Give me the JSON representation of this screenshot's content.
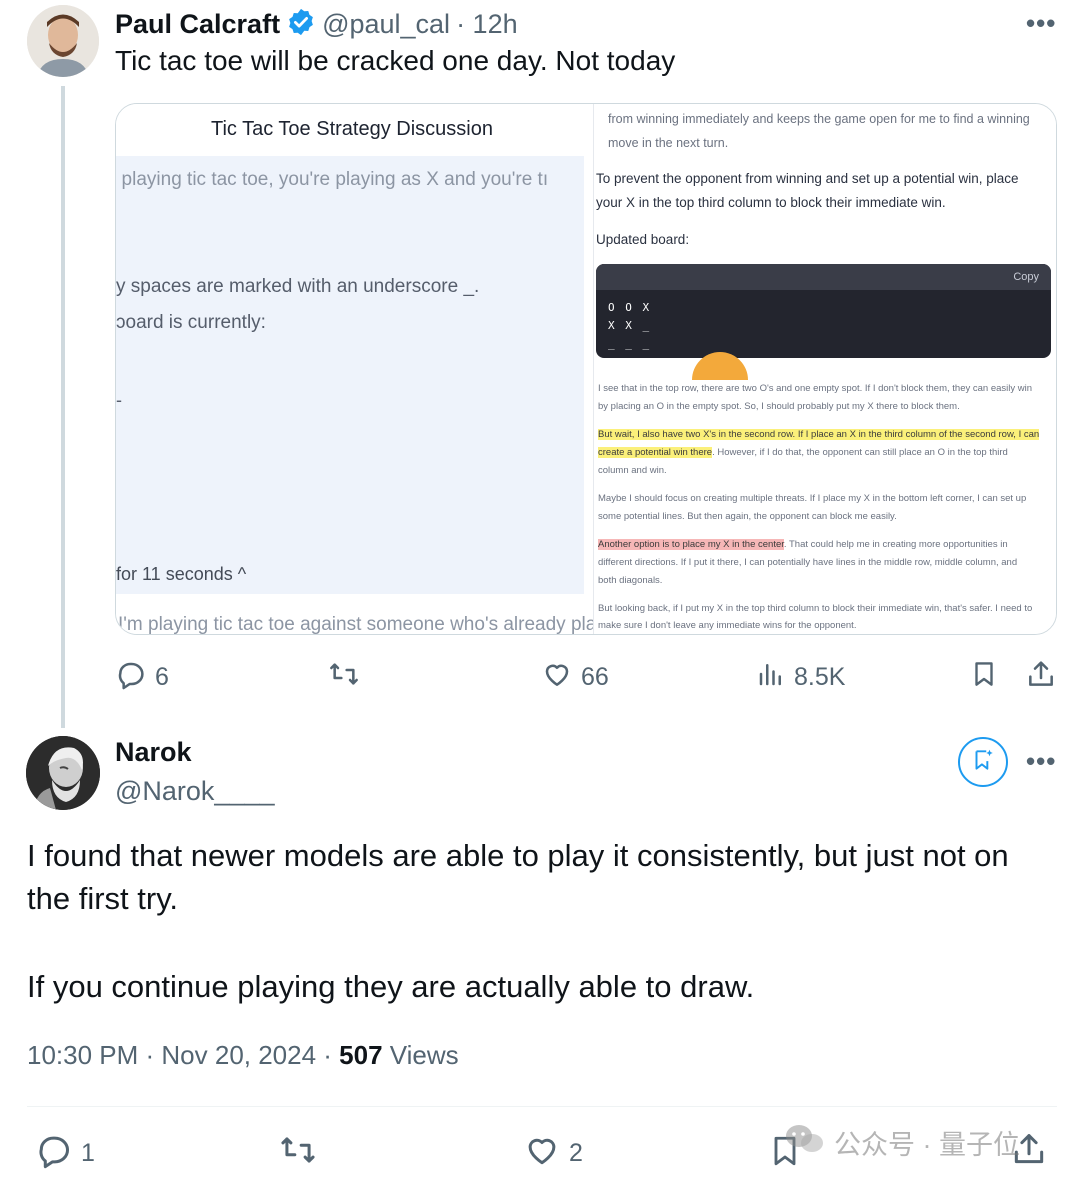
{
  "tweet1": {
    "author_name": "Paul Calcraft",
    "handle": "@paul_cal",
    "time": "· 12h",
    "text": "Tic tac toe will be cracked one day. Not today",
    "more_label": "•••",
    "media": {
      "left_title": "Tic Tac Toe Strategy Discussion",
      "left_line1": ": playing tic tac toe, you're playing as X and you're tı",
      "left_line2": "y spaces are marked with an underscore _.",
      "left_line3": "ɔoard is currently:",
      "left_marker": "-",
      "left_thought": "for 11 seconds ^",
      "left_bottom": "I'm playing tic tac toe against someone who's already placı",
      "right_top1": "from winning immediately and keeps the game open for me to find a winning",
      "right_top2": "move in the next turn.",
      "right_p1a": "To prevent the opponent from winning and set up a potential win, place",
      "right_p1b": "your X in the top third column to block their immediate win.",
      "right_updated": "Updated board:",
      "copy_label": "Copy",
      "board_row1": "O O X",
      "board_row2": "X X _",
      "board_row3": "_ _ _",
      "r1a": "I see that in the top row, there are two O's and one empty spot. If I don't block them, they can easily win",
      "r1b": "by placing an O in the empty spot. So, I should probably put my X there to block them.",
      "r2a": "But wait, I also have two X's in the second row. If I place an X in the third column of the second row, I can",
      "r2b_hl": "create a potential win there",
      "r2b_rest": ". However, if I do that, the opponent can still place an O in the top third",
      "r2c": "column and win.",
      "r3a": "Maybe I should focus on creating multiple threats. If I place my X in the bottom left corner, I can set up",
      "r3b": "some potential lines. But then again, the opponent can block me easily.",
      "r4a_hl": "Another option is to place my X in the center",
      "r4a_rest": ". That could help me in creating more opportunities in",
      "r4b": "different directions. If I put it there, I can potentially have lines in the middle row, middle column, and",
      "r4c": "both diagonals.",
      "r5a": "But looking back, if I put my X in the top third column to block their immediate win, that's safer. I need to",
      "r5b": "make sure I don't leave any immediate wins for the opponent."
    },
    "stats": {
      "replies": "6",
      "likes": "66",
      "views": "8.5K"
    }
  },
  "tweet2": {
    "author_name": "Narok",
    "handle": "@Narok____",
    "more_label": "•••",
    "line1": "I found that newer models are able to play it consistently, but just not on",
    "line2": "the first try.",
    "line3": "If you continue playing they are actually able to draw.",
    "time": "10:30 PM · Nov 20, 2024 · ",
    "views_count": "507",
    "views_label": " Views",
    "stats": {
      "replies": "1",
      "likes": "2"
    }
  },
  "watermark": "公众号 · 量子位",
  "colors": {
    "accent": "#1d9bf0",
    "muted": "#536471",
    "text": "#0f1419"
  },
  "icons": [
    "verified-badge-icon",
    "reply-icon",
    "retweet-icon",
    "like-icon",
    "views-icon",
    "bookmark-icon",
    "share-icon",
    "grok-icon",
    "wechat-icon"
  ]
}
